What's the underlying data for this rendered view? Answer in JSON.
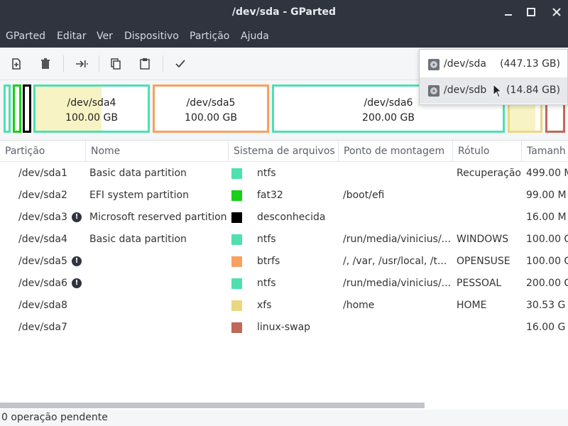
{
  "window": {
    "title": "/dev/sda - GParted"
  },
  "menu": [
    "GParted",
    "Editar",
    "Ver",
    "Dispositivo",
    "Partição",
    "Ajuda"
  ],
  "toolbar": {
    "icons": [
      "new-partition-icon",
      "delete-icon",
      "resize-move-icon",
      "copy-icon",
      "paste-icon",
      "apply-icon"
    ]
  },
  "partition_map": [
    {
      "name": "/dev/sda4",
      "size": "100.00 GB",
      "color": "#4ee0b0"
    },
    {
      "name": "/dev/sda5",
      "size": "100.00 GB",
      "color": "#f8a060"
    },
    {
      "name": "/dev/sda6",
      "size": "200.00 GB",
      "color": "#4ee0b0"
    }
  ],
  "devices": [
    {
      "name": "/dev/sda",
      "size": "(447.13 GB)"
    },
    {
      "name": "/dev/sdb",
      "size": "(14.84 GB)"
    }
  ],
  "table": {
    "headers": [
      "Partição",
      "Nome",
      "Sistema de arquivos",
      "Ponto de montagem",
      "Rótulo",
      "Tamanh"
    ],
    "rows": [
      {
        "partition": "/dev/sda1",
        "warn": false,
        "name": "Basic data partition",
        "fs": "ntfs",
        "fs_color": "#4ee0b0",
        "mount": "",
        "label": "Recuperação",
        "size": "499.00 M"
      },
      {
        "partition": "/dev/sda2",
        "warn": false,
        "name": "EFI system partition",
        "fs": "fat32",
        "fs_color": "#18d018",
        "mount": "/boot/efi",
        "label": "",
        "size": "99.00 M"
      },
      {
        "partition": "/dev/sda3",
        "warn": true,
        "name": "Microsoft reserved partition",
        "fs": "desconhecida",
        "fs_color": "#000000",
        "mount": "",
        "label": "",
        "size": "16.00 M"
      },
      {
        "partition": "/dev/sda4",
        "warn": false,
        "name": "Basic data partition",
        "fs": "ntfs",
        "fs_color": "#4ee0b0",
        "mount": "/run/media/vinicius/...",
        "label": "WINDOWS",
        "size": "100.00 G"
      },
      {
        "partition": "/dev/sda5",
        "warn": true,
        "name": "",
        "fs": "btrfs",
        "fs_color": "#f8a060",
        "mount": "/, /var, /usr/local, /t...",
        "label": "OPENSUSE",
        "size": "100.00 G"
      },
      {
        "partition": "/dev/sda6",
        "warn": true,
        "name": "",
        "fs": "ntfs",
        "fs_color": "#4ee0b0",
        "mount": "/run/media/vinicius/...",
        "label": "PESSOAL",
        "size": "200.00 G"
      },
      {
        "partition": "/dev/sda8",
        "warn": false,
        "name": "",
        "fs": "xfs",
        "fs_color": "#ecd682",
        "mount": "/home",
        "label": "HOME",
        "size": "30.53 G"
      },
      {
        "partition": "/dev/sda7",
        "warn": false,
        "name": "",
        "fs": "linux-swap",
        "fs_color": "#c06858",
        "mount": "",
        "label": "",
        "size": "16.00 G"
      }
    ]
  },
  "status": {
    "text": "0 operação pendente"
  }
}
